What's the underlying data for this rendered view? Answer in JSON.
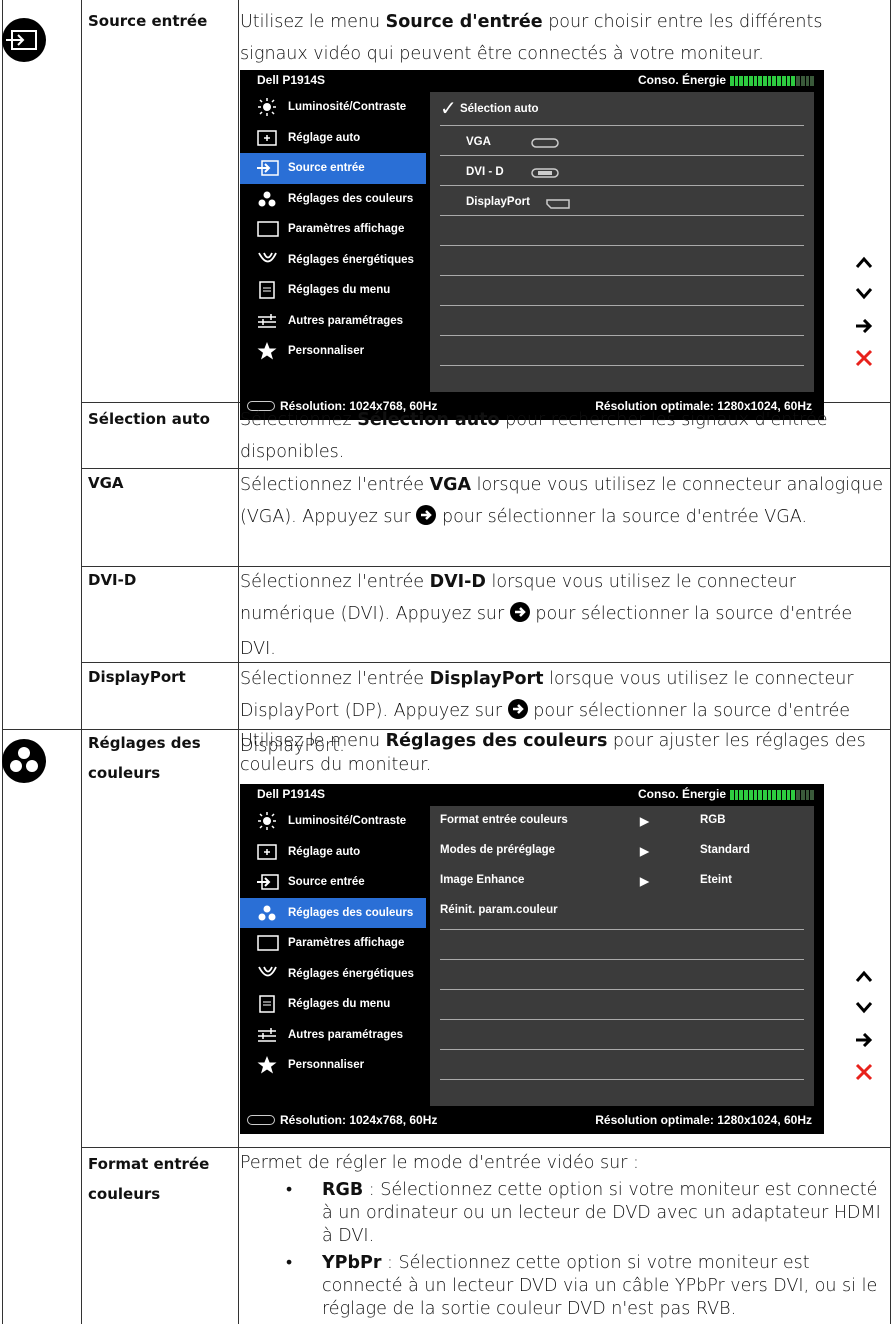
{
  "rows": {
    "source_label": "Source entrée",
    "source_desc_pre": "Utilisez le menu ",
    "source_desc_bold": "Source d'entrée",
    "source_desc_post": " pour choisir entre les différents signaux vidéo qui peuvent être connectés à votre moniteur.",
    "auto_label": "Sélection auto",
    "auto_desc_pre": "Sélectionnez ",
    "auto_desc_bold": "Sélection auto",
    "auto_desc_post": " pour rechercher les signaux d'entrée disponibles.",
    "vga_label": "VGA",
    "vga_desc_pre": "Sélectionnez l'entrée ",
    "vga_desc_bold": "VGA",
    "vga_desc_mid": " lorsque vous utilisez le connecteur analogique (VGA). Appuyez sur ",
    "vga_desc_post": " pour sélectionner la source d'entrée VGA.",
    "dvi_label": "DVI-D",
    "dvi_desc_pre": "Sélectionnez l'entrée ",
    "dvi_desc_bold": "DVI-D",
    "dvi_desc_mid": " lorsque vous utilisez le connecteur numérique (DVI). Appuyez sur ",
    "dvi_desc_post": " pour sélectionner la source d'entrée DVI.",
    "dp_label": "DisplayPort",
    "dp_desc_pre": "Sélectionnez l'entrée ",
    "dp_desc_bold": "DisplayPort",
    "dp_desc_mid": " lorsque vous utilisez le connecteur DisplayPort (DP). Appuyez sur ",
    "dp_desc_post": " pour sélectionner la source d'entrée DisplayPort.",
    "color_label": "Réglages des couleurs",
    "color_desc_pre": "Utilisez le menu ",
    "color_desc_bold": "Réglages des couleurs",
    "color_desc_post": " pour ajuster les réglages des couleurs du moniteur.",
    "format_label": "Format entrée couleurs",
    "format_desc": "Permet de régler le mode d'entrée vidéo sur :",
    "rgb_bold": "RGB",
    "rgb_text": " : Sélectionnez cette option si votre moniteur est connecté à un ordinateur ou un lecteur de DVD avec un adaptateur HDMI à DVI.",
    "ypbpr_bold": "YPbPr",
    "ypbpr_text": " : Sélectionnez cette option si votre moniteur est connecté à un lecteur DVD via un câble YPbPr vers DVI, ou si le réglage de la sortie couleur DVD n'est pas RVB."
  },
  "osd": {
    "model": "Dell P1914S",
    "energy": "Conso. Énergie",
    "energy_level": 0.78,
    "menu": [
      "Luminosité/Contraste",
      "Réglage auto",
      "Source entrée",
      "Réglages des couleurs",
      "Paramètres affichage",
      "Réglages énergétiques",
      "Réglages du menu",
      "Autres paramétrages",
      "Personnaliser"
    ],
    "footer_left": "Résolution: 1024x768,  60Hz",
    "footer_right": "Résolution optimale: 1280x1024,  60Hz",
    "source_options": [
      "Sélection auto",
      "VGA",
      "DVI - D",
      "DisplayPort"
    ],
    "color_options": [
      {
        "name": "Format entrée couleurs",
        "value": "RGB"
      },
      {
        "name": "Modes de préréglage",
        "value": "Standard"
      },
      {
        "name": "Image Enhance",
        "value": "Eteint"
      },
      {
        "name": "Réinit. param.couleur",
        "value": ""
      }
    ]
  },
  "colors": {
    "menu_selected": "#2a6fd6",
    "panel": "#3b3b3b",
    "exit": "#e8211b"
  }
}
